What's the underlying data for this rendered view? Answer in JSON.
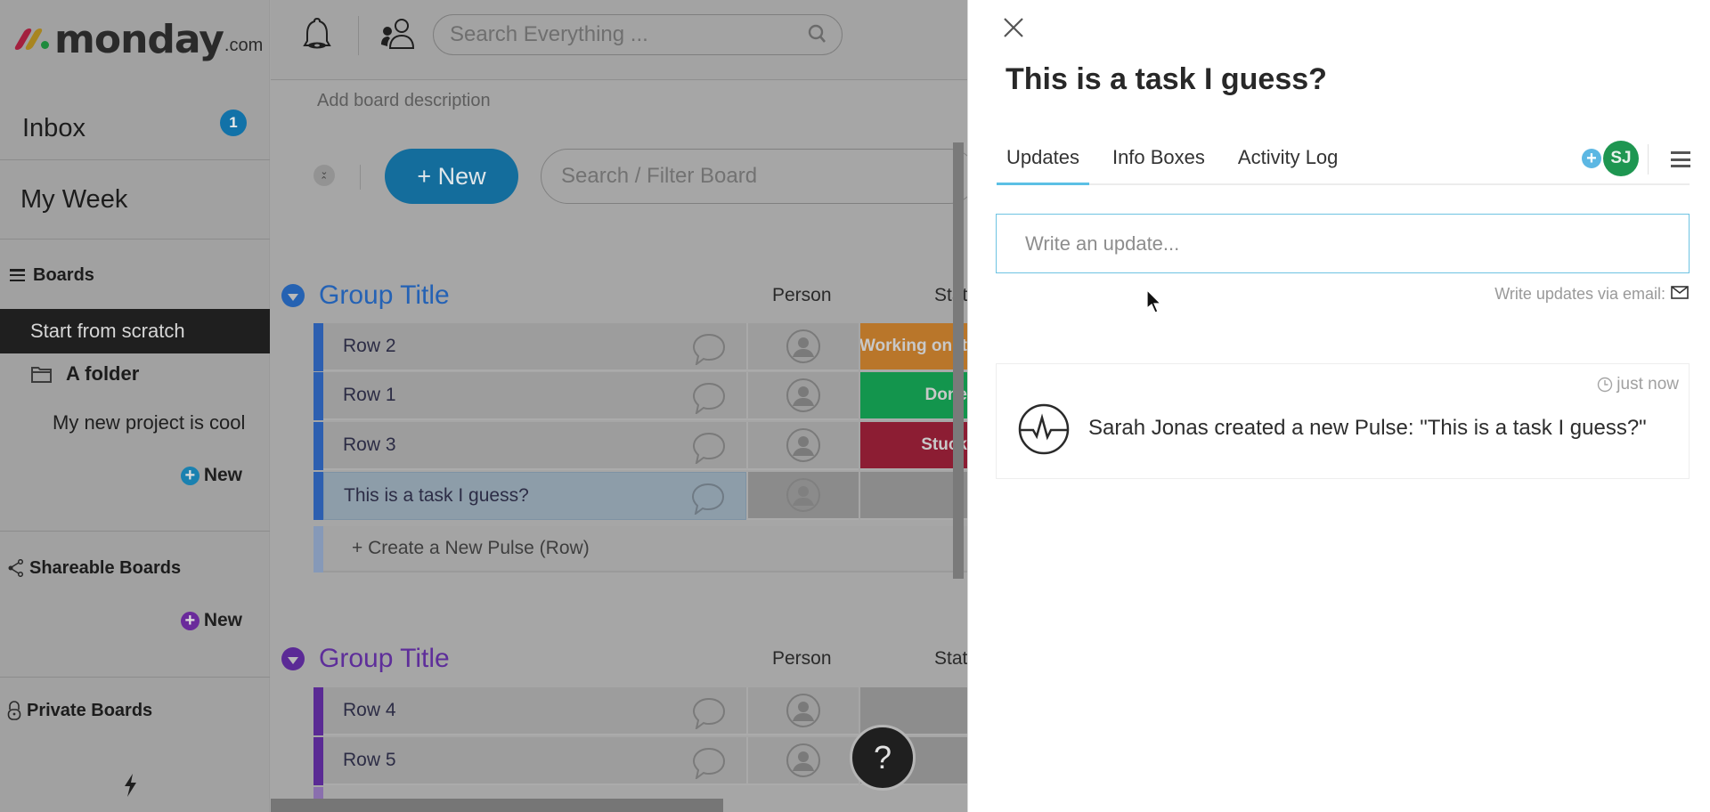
{
  "sidebar": {
    "logo": {
      "text": "monday",
      "tld": ".com",
      "mark_colors": [
        "#b3123f",
        "#c59813",
        "#179a3d"
      ]
    },
    "inbox": {
      "label": "Inbox",
      "badge": "1"
    },
    "my_week": {
      "label": "My Week"
    },
    "boards_header": {
      "label": "Boards"
    },
    "active_item": {
      "label": "Start from scratch"
    },
    "folder": {
      "label": "A folder",
      "items": [
        {
          "label": "My new project is cool"
        }
      ]
    },
    "new_main": {
      "label": "New"
    },
    "shareable": {
      "label": "Shareable Boards",
      "new_label": "New"
    },
    "private": {
      "label": "Private Boards"
    }
  },
  "topbar": {
    "search_placeholder": "Search Everything ..."
  },
  "board": {
    "description_placeholder": "Add board description",
    "new_button": "+ New",
    "filter_placeholder": "Search / Filter Board",
    "groups": [
      {
        "title": "Group Title",
        "color": "#1f5fb3",
        "columns": {
          "person": "Person",
          "status": "Status"
        },
        "rows": [
          {
            "name": "Row 2",
            "status": "Working on it",
            "status_color": "#b9762a"
          },
          {
            "name": "Row 1",
            "status": "Done",
            "status_color": "#13954d"
          },
          {
            "name": "Row 3",
            "status": "Stuck",
            "status_color": "#8c1d33"
          },
          {
            "name": "This is a task I guess?",
            "status": "",
            "status_color": "#8b8b8b",
            "selected": true
          }
        ],
        "create_row_label": "+ Create a New Pulse (Row)"
      },
      {
        "title": "Group Title",
        "color": "#5b2a96",
        "columns": {
          "person": "Person",
          "status": "Status"
        },
        "rows": [
          {
            "name": "Row 4",
            "status": "",
            "status_color": "#8d8d8d"
          },
          {
            "name": "Row 5",
            "status": "",
            "status_color": "#8d8d8d"
          }
        ]
      }
    ],
    "help_label": "?"
  },
  "panel": {
    "title": "This is a task I guess?",
    "tabs": [
      {
        "label": "Updates",
        "active": true
      },
      {
        "label": "Info Boxes",
        "active": false
      },
      {
        "label": "Activity Log",
        "active": false
      }
    ],
    "subscriber_initials": "SJ",
    "update_placeholder": "Write an update...",
    "email_hint": "Write updates via email:",
    "activity": [
      {
        "time": "just now",
        "text": "Sarah Jonas created a new Pulse: \"This is a task I guess?\""
      }
    ]
  }
}
